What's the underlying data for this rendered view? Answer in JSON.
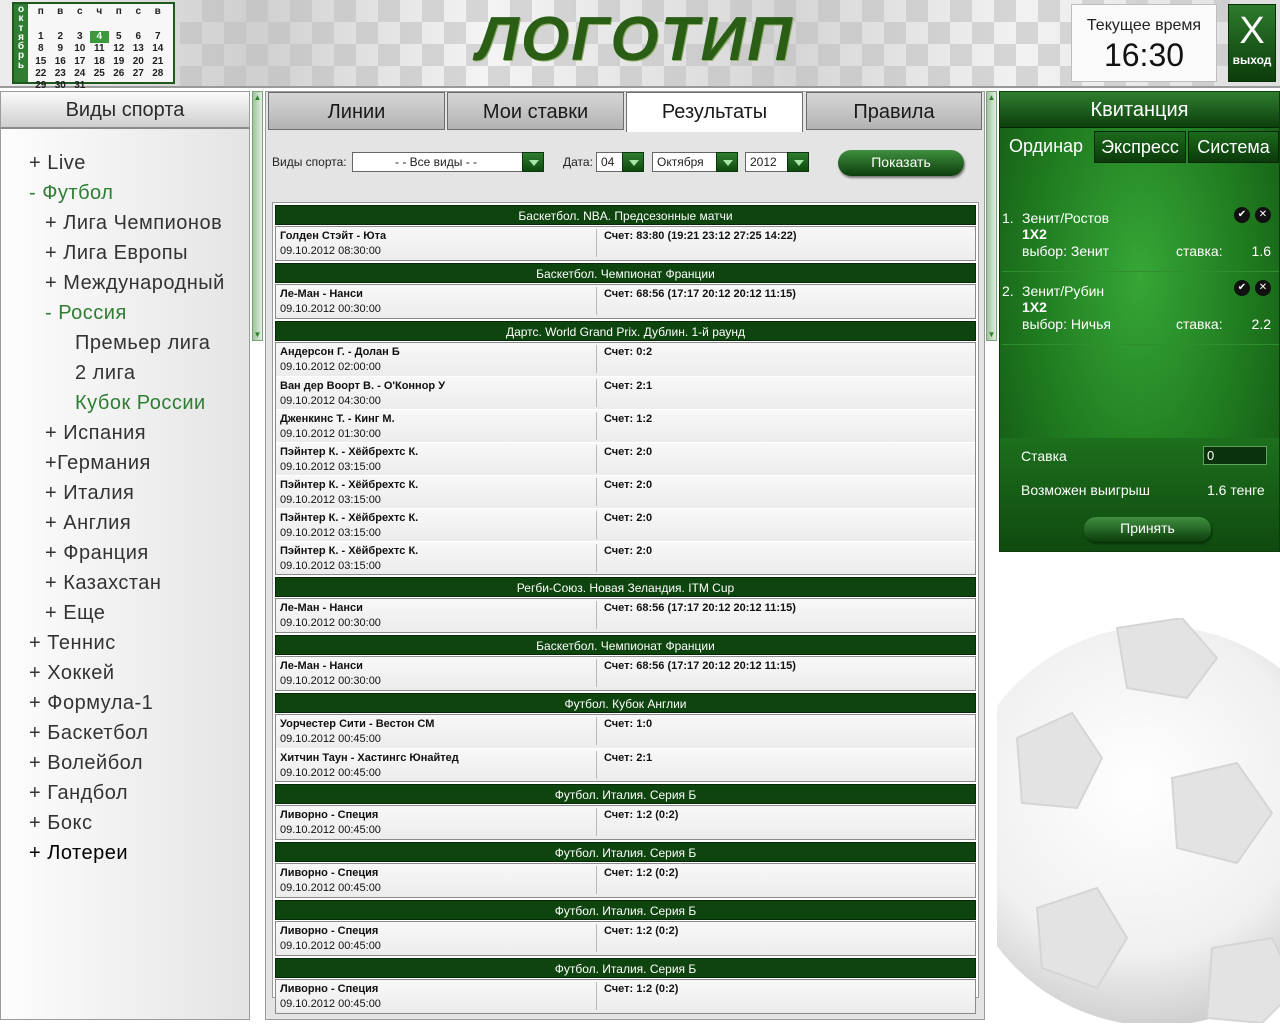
{
  "calendar": {
    "month_letters": [
      "о",
      "к",
      "т",
      "я",
      "б",
      "р",
      "ь"
    ],
    "weekdays": [
      "п",
      "в",
      "с",
      "ч",
      "п",
      "с",
      "в"
    ],
    "days": [
      [
        "",
        "",
        "",
        "",
        "",
        "",
        ""
      ],
      [
        "1",
        "2",
        "3",
        "4",
        "5",
        "6",
        "7"
      ],
      [
        "8",
        "9",
        "10",
        "11",
        "12",
        "13",
        "14"
      ],
      [
        "15",
        "16",
        "17",
        "18",
        "19",
        "20",
        "21"
      ],
      [
        "22",
        "23",
        "24",
        "25",
        "26",
        "27",
        "28"
      ],
      [
        "29",
        "30",
        "31",
        "",
        "",
        "",
        ""
      ]
    ],
    "today": "4"
  },
  "header": {
    "logo": "ЛОГОТИП",
    "time_label": "Текущее время",
    "time_value": "16:30",
    "exit_icon": "X",
    "exit_label": "выход"
  },
  "sidebar": {
    "title": "Виды спорта",
    "items": [
      {
        "label": "+ Live",
        "level": 0
      },
      {
        "label": "- Футбол",
        "level": 0,
        "state": "expanded"
      },
      {
        "label": "+ Лига Чемпионов",
        "level": 1
      },
      {
        "label": "+ Лига Европы",
        "level": 1
      },
      {
        "label": "+ Международный",
        "level": 1
      },
      {
        "label": "- Россия",
        "level": 1,
        "state": "expanded"
      },
      {
        "label": "Премьер лига",
        "level": 2
      },
      {
        "label": "2 лига",
        "level": 2
      },
      {
        "label": "Кубок России",
        "level": 2,
        "state": "selected"
      },
      {
        "label": "+ Испания",
        "level": 1
      },
      {
        "label": "+Германия",
        "level": 1
      },
      {
        "label": "+ Италия",
        "level": 1
      },
      {
        "label": "+ Англия",
        "level": 1
      },
      {
        "label": "+ Франция",
        "level": 1
      },
      {
        "label": "+ Казахстан",
        "level": 1
      },
      {
        "label": "+ Еще",
        "level": 1
      },
      {
        "label": "+ Теннис",
        "level": 0
      },
      {
        "label": "+ Хоккей",
        "level": 0
      },
      {
        "label": "+ Формула-1",
        "level": 0
      },
      {
        "label": "+ Баскетбол",
        "level": 0
      },
      {
        "label": "+ Волейбол",
        "level": 0
      },
      {
        "label": "+ Гандбол",
        "level": 0
      },
      {
        "label": "+ Бокс",
        "level": 0
      },
      {
        "label": "+ Лотереи",
        "level": 0,
        "state": "highlight"
      }
    ]
  },
  "tabs": [
    {
      "label": "Линии"
    },
    {
      "label": "Мои ставки"
    },
    {
      "label": "Результаты",
      "active": true
    },
    {
      "label": "Правила"
    }
  ],
  "filters": {
    "sport_label": "Виды спорта:",
    "sport_value": "- - Все виды - -",
    "date_label": "Дата:",
    "day_value": "04",
    "month_value": "Октября",
    "year_value": "2012",
    "show_button": "Показать"
  },
  "results": [
    {
      "title": "Баскетбол. NBA. Предсезонные матчи",
      "rows": [
        {
          "match": "Голден Стэйт - Юта",
          "date": "09.10.2012 08:30:00",
          "score": "Счет: 83:80 (19:21 23:12 27:25 14:22)"
        }
      ]
    },
    {
      "title": "Баскетбол. Чемпионат Франции",
      "rows": [
        {
          "match": "Ле-Ман - Нанси",
          "date": "09.10.2012 00:30:00",
          "score": "Счет: 68:56 (17:17 20:12 20:12 11:15)"
        }
      ]
    },
    {
      "title": "Дартс. World Grand Prix. Дублин. 1-й раунд",
      "rows": [
        {
          "match": "Андерсон Г. - Долан Б",
          "date": "09.10.2012 02:00:00",
          "score": "Счет: 0:2"
        },
        {
          "match": "Ван дер Воорт В. - О'Коннор У",
          "date": "09.10.2012 04:30:00",
          "score": "Счет: 2:1"
        },
        {
          "match": "Дженкинс Т. - Кинг М.",
          "date": "09.10.2012 01:30:00",
          "score": "Счет: 1:2"
        },
        {
          "match": "Пэйнтер К. - Хёйбрехтс К.",
          "date": "09.10.2012 03:15:00",
          "score": "Счет: 2:0"
        },
        {
          "match": "Пэйнтер К. - Хёйбрехтс К.",
          "date": "09.10.2012 03:15:00",
          "score": "Счет: 2:0"
        },
        {
          "match": "Пэйнтер К. - Хёйбрехтс К.",
          "date": "09.10.2012 03:15:00",
          "score": "Счет: 2:0"
        },
        {
          "match": "Пэйнтер К. - Хёйбрехтс К.",
          "date": "09.10.2012 03:15:00",
          "score": "Счет: 2:0"
        }
      ]
    },
    {
      "title": "Регби-Союз. Новая Зеландия. ITM Cup",
      "rows": [
        {
          "match": "Ле-Ман - Нанси",
          "date": "09.10.2012 00:30:00",
          "score": "Счет: 68:56 (17:17 20:12 20:12 11:15)"
        }
      ]
    },
    {
      "title": "Баскетбол. Чемпионат Франции",
      "rows": [
        {
          "match": "Ле-Ман - Нанси",
          "date": "09.10.2012 00:30:00",
          "score": "Счет: 68:56 (17:17 20:12 20:12 11:15)"
        }
      ]
    },
    {
      "title": "Футбол. Кубок Англии",
      "rows": [
        {
          "match": "Уорчестер Сити - Вестон СМ",
          "date": "09.10.2012 00:45:00",
          "score": "Счет: 1:0"
        },
        {
          "match": "Хитчин Таун - Хастингс Юнайтед",
          "date": "09.10.2012 00:45:00",
          "score": "Счет: 2:1"
        }
      ]
    },
    {
      "title": "Футбол. Италия. Серия Б",
      "rows": [
        {
          "match": "Ливорно - Специя",
          "date": "09.10.2012 00:45:00",
          "score": "Счет: 1:2 (0:2)"
        }
      ]
    },
    {
      "title": "Футбол. Италия. Серия Б",
      "rows": [
        {
          "match": "Ливорно - Специя",
          "date": "09.10.2012 00:45:00",
          "score": "Счет: 1:2 (0:2)"
        }
      ]
    },
    {
      "title": "Футбол. Италия. Серия Б",
      "rows": [
        {
          "match": "Ливорно - Специя",
          "date": "09.10.2012 00:45:00",
          "score": "Счет: 1:2 (0:2)"
        }
      ]
    },
    {
      "title": "Футбол. Италия. Серия Б",
      "rows": [
        {
          "match": "Ливорно - Специя",
          "date": "09.10.2012 00:45:00",
          "score": "Счет: 1:2 (0:2)"
        }
      ]
    }
  ],
  "slip": {
    "title": "Квитанция",
    "tabs": [
      {
        "label": "Ординар",
        "active": true
      },
      {
        "label": "Экспресс"
      },
      {
        "label": "Система"
      }
    ],
    "bets": [
      {
        "num": "1.",
        "event": "Зенит/Ростов",
        "type": "1X2",
        "choice": "выбор: Зенит",
        "stake_label": "ставка:",
        "stake_value": "1.6"
      },
      {
        "num": "2.",
        "event": "Зенит/Рубин",
        "type": "1X2",
        "choice": "выбор: Ничья",
        "stake_label": "ставка:",
        "stake_value": "2.2"
      }
    ],
    "stake_label": "Ставка",
    "stake_value": "0",
    "win_label": "Возможен выигрыш",
    "win_value": "1.6 тенге",
    "accept_button": "Принять"
  },
  "colors": {
    "accent": "#2e7d32",
    "dark_green": "#0e440e"
  }
}
